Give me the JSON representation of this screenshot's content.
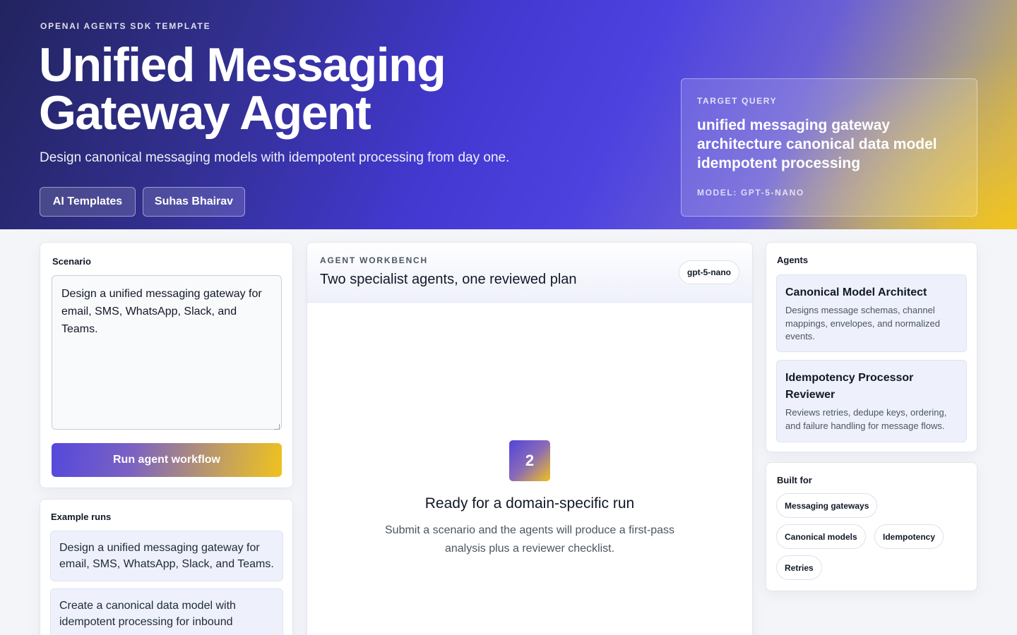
{
  "hero": {
    "eyebrow": "OPENAI AGENTS SDK TEMPLATE",
    "title_line1": "Unified Messaging",
    "title_line2": "Gateway Agent",
    "subtitle": "Design canonical messaging models with idempotent processing from day one.",
    "buttons": [
      "AI Templates",
      "Suhas Bhairav"
    ],
    "target": {
      "label": "TARGET QUERY",
      "query": "unified messaging gateway architecture canonical data model idempotent processing",
      "model": "MODEL: GPT-5-NANO"
    }
  },
  "scenario": {
    "heading": "Scenario",
    "text": "Design a unified messaging gateway for email, SMS, WhatsApp, Slack, and Teams.",
    "run_label": "Run agent workflow"
  },
  "examples": {
    "heading": "Example runs",
    "items": [
      "Design a unified messaging gateway for email, SMS, WhatsApp, Slack, and Teams.",
      "Create a canonical data model with idempotent processing for inbound"
    ]
  },
  "workbench": {
    "eyebrow": "AGENT WORKBENCH",
    "title": "Two specialist agents, one reviewed plan",
    "model_pill": "gpt-5-nano",
    "step": "2",
    "ready_title": "Ready for a domain-specific run",
    "ready_desc": "Submit a scenario and the agents will produce a first-pass analysis plus a reviewer checklist."
  },
  "agents": {
    "heading": "Agents",
    "items": [
      {
        "name": "Canonical Model Architect",
        "desc": "Designs message schemas, channel mappings, envelopes, and normalized events."
      },
      {
        "name": "Idempotency Processor Reviewer",
        "desc": "Reviews retries, dedupe keys, ordering, and failure handling for message flows."
      }
    ]
  },
  "built_for": {
    "heading": "Built for",
    "tags": [
      "Messaging gateways",
      "Canonical models",
      "Idempotency",
      "Retries"
    ]
  }
}
